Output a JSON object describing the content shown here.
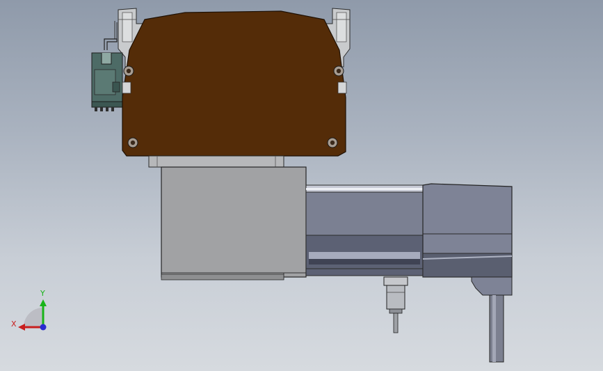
{
  "viewport": {
    "background_top": "#8f9aaa",
    "background_bottom": "#d6dadf"
  },
  "model": {
    "cover_color": "#542c08",
    "motor_color": "#a1a2a4",
    "body_color": "#7a7f91",
    "connector_color": "#4d6b66"
  },
  "triad": {
    "x_label": "X",
    "y_label": "Y",
    "x_color": "#c81e1e",
    "y_color": "#19b419",
    "z_color": "#2a2ad0"
  }
}
